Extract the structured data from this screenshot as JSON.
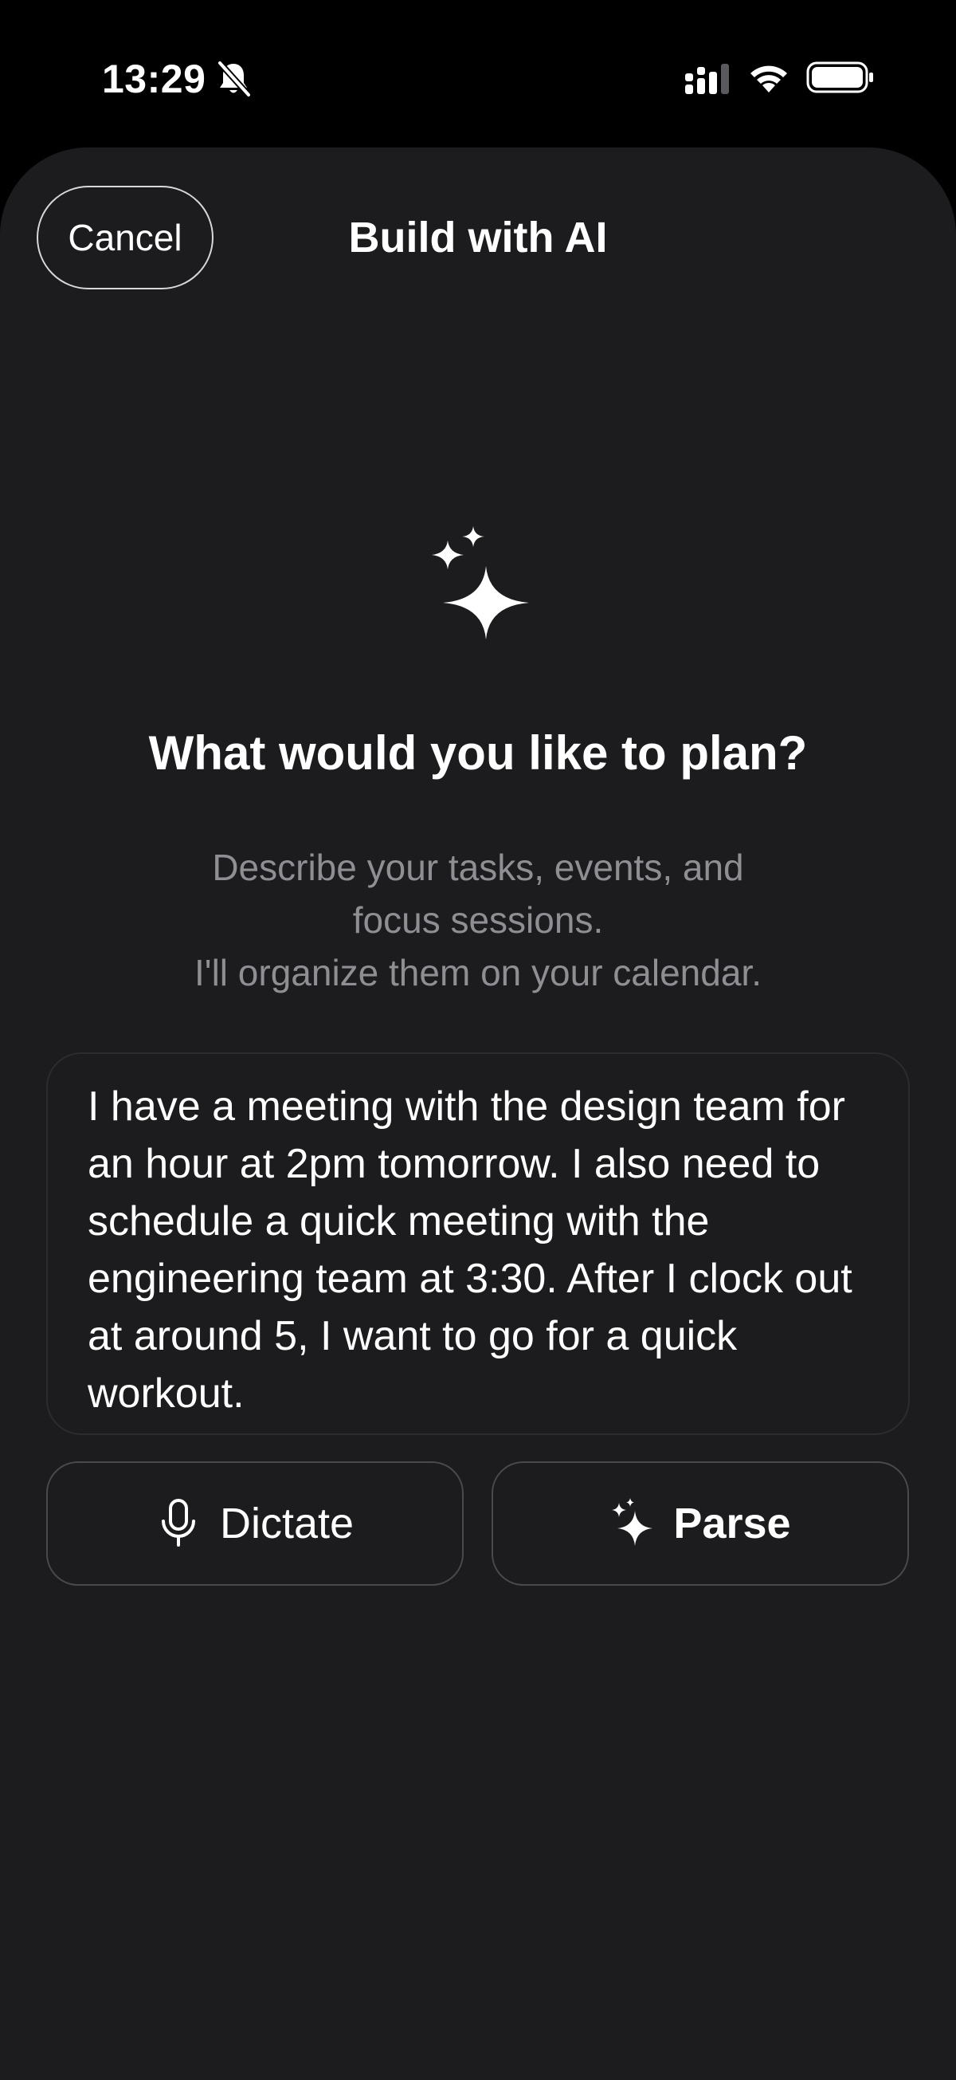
{
  "status_bar": {
    "time": "13:29",
    "icons": [
      "bell-slash-icon",
      "cellular-signal-icon",
      "wifi-icon",
      "battery-icon"
    ]
  },
  "header": {
    "cancel_label": "Cancel",
    "title": "Build with AI"
  },
  "hero": {
    "icon": "sparkles-icon",
    "headline": "What would you like to plan?",
    "subtext_lines": [
      "Describe your tasks, events, and",
      "focus sessions.",
      "I'll organize them on your calendar."
    ]
  },
  "prompt": {
    "value": "I have a meeting with the design team for an hour at 2pm tomorrow. I also need to schedule a quick meeting with the engineering team at 3:30. After I clock out at around 5, I want to go for a quick workout."
  },
  "actions": {
    "dictate_label": "Dictate",
    "dictate_icon": "microphone-icon",
    "parse_label": "Parse",
    "parse_icon": "sparkles-icon"
  },
  "colors": {
    "background": "#000000",
    "sheet": "#1c1c1e",
    "text_primary": "#ffffff",
    "text_secondary": "#8e8e93",
    "border": "#4a4a4c"
  }
}
